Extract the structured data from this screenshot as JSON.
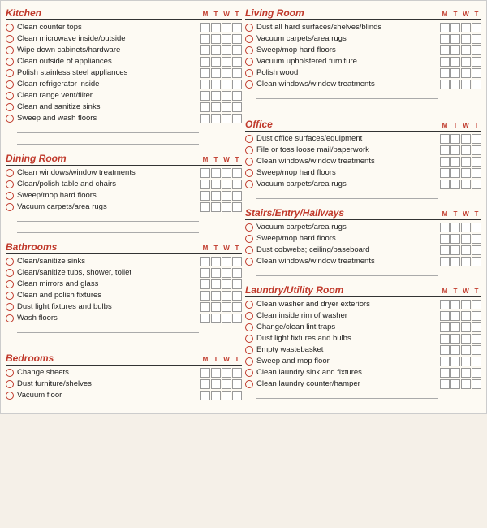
{
  "columns": [
    {
      "sections": [
        {
          "id": "kitchen",
          "title": "Kitchen",
          "showMTWT": true,
          "items": [
            "Clean counter tops",
            "Clean microwave inside/outside",
            "Wipe down cabinets/hardware",
            "Clean outside of appliances",
            "Polish stainless steel appliances",
            "Clean refrigerator inside",
            "Clean range vent/filter",
            "Clean and sanitize sinks",
            "Sweep and wash floors"
          ],
          "blanks": 2
        },
        {
          "id": "dining-room",
          "title": "Dining Room",
          "showMTWT": true,
          "items": [
            "Clean windows/window treatments",
            "Clean/polish table and chairs",
            "Sweep/mop hard floors",
            "Vacuum carpets/area rugs"
          ],
          "blanks": 2
        },
        {
          "id": "bathrooms",
          "title": "Bathrooms",
          "showMTWT": true,
          "items": [
            "Clean/sanitize sinks",
            "Clean/sanitize tubs, shower, toilet",
            "Clean mirrors and glass",
            "Clean and polish fixtures",
            "Dust light fixtures and bulbs",
            "Wash floors"
          ],
          "blanks": 2
        },
        {
          "id": "bedrooms",
          "title": "Bedrooms",
          "showMTWT": true,
          "items": [
            "Change sheets",
            "Dust furniture/shelves",
            "Vacuum floor"
          ],
          "blanks": 0
        }
      ]
    },
    {
      "sections": [
        {
          "id": "living-room",
          "title": "Living Room",
          "showMTWT": true,
          "items": [
            "Dust all hard surfaces/shelves/blinds",
            "Vacuum carpets/area rugs",
            "Sweep/mop hard floors",
            "Vacuum upholstered furniture",
            "Polish wood",
            "Clean windows/window treatments"
          ],
          "blanks": 2
        },
        {
          "id": "office",
          "title": "Office",
          "showMTWT": true,
          "items": [
            "Dust office surfaces/equipment",
            "File or toss loose mail/paperwork",
            "Clean windows/window treatments",
            "Sweep/mop hard floors",
            "Vacuum carpets/area rugs"
          ],
          "blanks": 1
        },
        {
          "id": "stairs",
          "title": "Stairs/Entry/Hallways",
          "showMTWT": true,
          "items": [
            "Vacuum carpets/area rugs",
            "Sweep/mop hard floors",
            "Dust cobwebs; ceiling/baseboard",
            "Clean windows/window treatments"
          ],
          "blanks": 1
        },
        {
          "id": "laundry",
          "title": "Laundry/Utility Room",
          "showMTWT": true,
          "items": [
            "Clean washer and dryer exteriors",
            "Clean inside rim of washer",
            "Change/clean lint traps",
            "Dust light fixtures and bulbs",
            "Empty wastebasket",
            "Sweep and mop floor",
            "Clean laundry sink and fixtures",
            "Clean laundry counter/hamper"
          ],
          "blanks": 1
        }
      ]
    }
  ],
  "mtwt_letters": [
    "M",
    "T",
    "W",
    "T"
  ]
}
